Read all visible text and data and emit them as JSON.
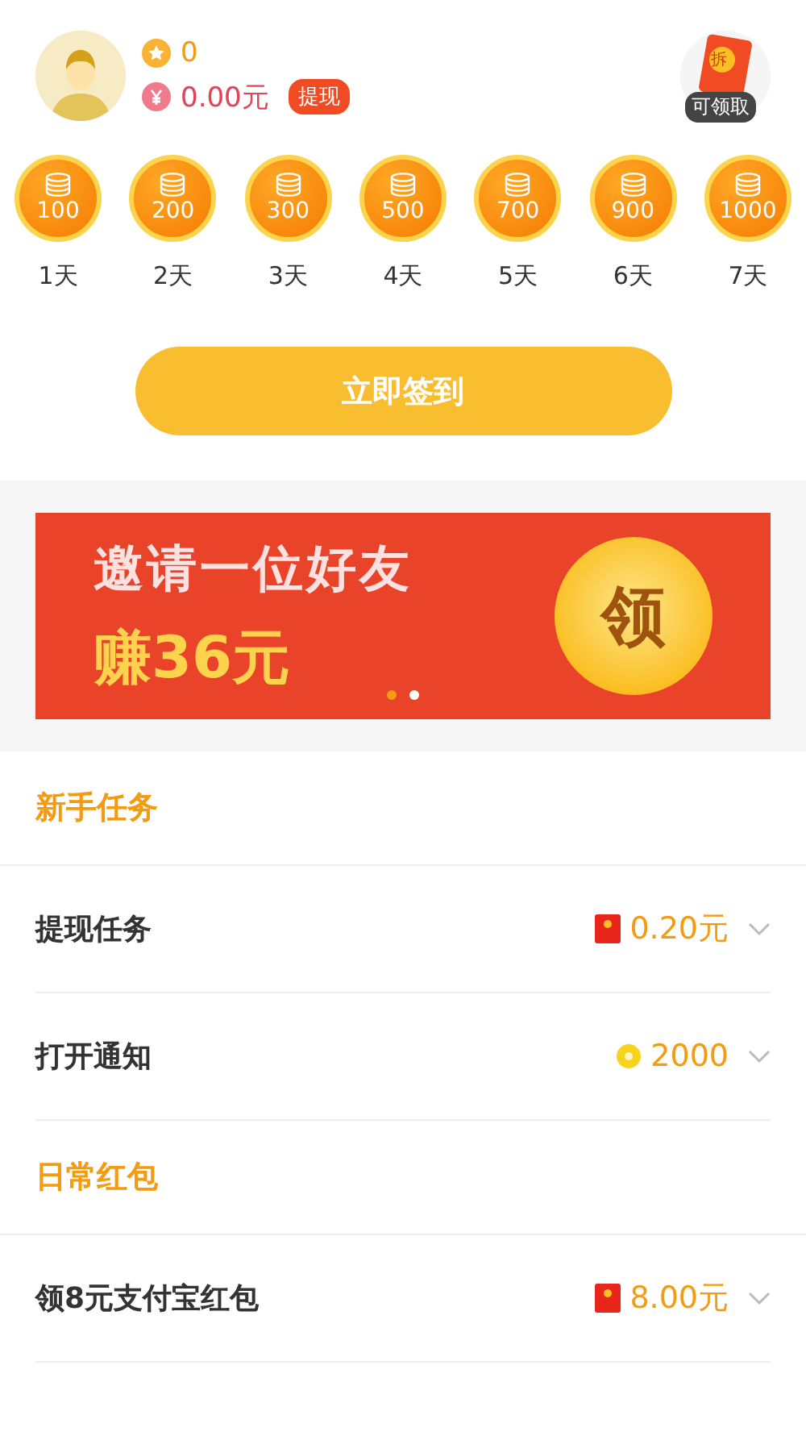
{
  "profile": {
    "coins": "0",
    "balance": "0.00元",
    "withdraw_button": "提现",
    "bonus_badge": "可领取",
    "bonus_glyph": "拆"
  },
  "checkin_days": [
    {
      "amount": "100",
      "day": "1天"
    },
    {
      "amount": "200",
      "day": "2天"
    },
    {
      "amount": "300",
      "day": "3天"
    },
    {
      "amount": "500",
      "day": "4天"
    },
    {
      "amount": "700",
      "day": "5天"
    },
    {
      "amount": "900",
      "day": "6天"
    },
    {
      "amount": "1000",
      "day": "7天"
    }
  ],
  "checkin_button": "立即签到",
  "banner": {
    "headline": "邀请一位好友",
    "reward_prefix": "赚",
    "reward": "36元",
    "coin_label": "领",
    "dots": [
      {
        "selected": true
      },
      {
        "selected": false
      }
    ]
  },
  "sections": [
    {
      "title": "新手任务",
      "tasks": [
        {
          "label": "提现任务",
          "kind": "redpacket",
          "reward": "0.20元"
        },
        {
          "label": "打开通知",
          "kind": "coin",
          "reward": "2000"
        }
      ]
    },
    {
      "title": "日常红包",
      "tasks": [
        {
          "label": "领8元支付宝红包",
          "kind": "redpacket",
          "reward": "8.00元"
        }
      ]
    }
  ]
}
